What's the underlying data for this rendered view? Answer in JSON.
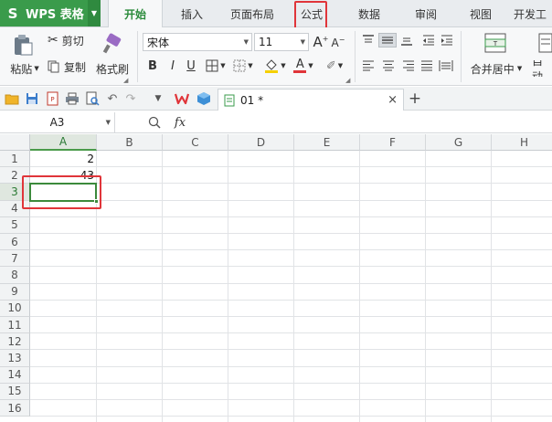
{
  "app": {
    "name": "WPS 表格",
    "logo": "S"
  },
  "menu_tabs": [
    {
      "label": "开始",
      "active": true
    },
    {
      "label": "插入",
      "active": false
    },
    {
      "label": "页面布局",
      "active": false
    },
    {
      "label": "公式",
      "active": false,
      "highlighted": true
    },
    {
      "label": "数据",
      "active": false
    },
    {
      "label": "审阅",
      "active": false
    },
    {
      "label": "视图",
      "active": false
    },
    {
      "label": "开发工",
      "active": false
    }
  ],
  "ribbon": {
    "paste_label": "粘贴",
    "cut_label": "剪切",
    "copy_label": "复制",
    "format_painter_label": "格式刷",
    "font_name": "宋体",
    "font_size": "11",
    "bold": "B",
    "italic": "I",
    "underline": "U",
    "grow_font": "A",
    "shrink_font": "A",
    "font_color_letter": "A",
    "merge_center_label": "合并居中",
    "auto_wrap_label": "自动"
  },
  "document": {
    "tab_label": "01 *",
    "close_glyph": "×",
    "new_tab_glyph": "+"
  },
  "formula_bar": {
    "name_box": "A3",
    "fx_label": "fx"
  },
  "sheet": {
    "columns": [
      "A",
      "B",
      "C",
      "D",
      "E",
      "F",
      "G",
      "H"
    ],
    "rows": [
      "1",
      "2",
      "3",
      "4",
      "5",
      "6",
      "7",
      "8",
      "9",
      "10",
      "11",
      "12",
      "13",
      "14",
      "15",
      "16"
    ],
    "selected_column": "A",
    "selected_row": "3",
    "cells": [
      {
        "ref": "A1",
        "value": "2"
      },
      {
        "ref": "A2",
        "value": "43"
      }
    ]
  },
  "colors": {
    "brand_green": "#3a9b4b",
    "highlight_red": "#e0353a",
    "selection_green": "#3c8a3c"
  }
}
